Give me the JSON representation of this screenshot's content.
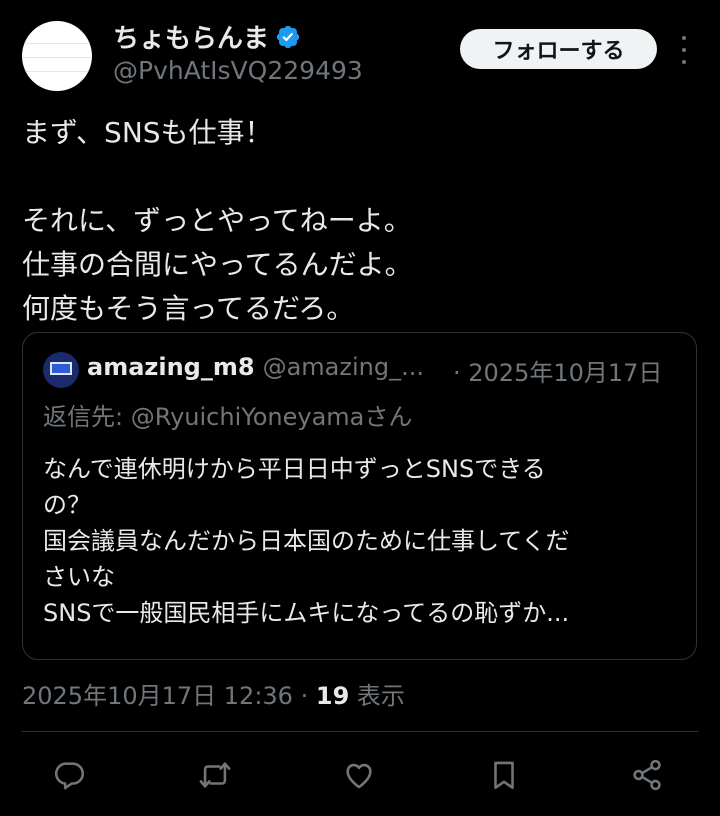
{
  "author": {
    "display_name": "ちょもらんま",
    "handle": "@PvhAtIsVQ229493",
    "follow_label": "フォローする"
  },
  "tweet": {
    "lines": [
      "まず、SNSも仕事！",
      "",
      "それに、ずっとやってねーよ。",
      "仕事の合間にやってるんだよ。",
      "何度もそう言ってるだろ。"
    ],
    "timestamp": "2025年10月17日 12:36",
    "separator": "·",
    "views_count": "19",
    "views_label": "表示"
  },
  "quoted": {
    "display_name": "amazing_m8",
    "handle": "@amazing_...",
    "date": "· 2025年10月17日",
    "reply_prefix": "返信先:",
    "reply_target": "@RyuichiYoneyamaさん",
    "lines": [
      "なんで連休明けから平日日中ずっとSNSできる",
      "の？",
      "国会議員なんだから日本国のために仕事してくだ",
      "さいな",
      "SNSで一般国民相手にムキになってるの恥ずか..."
    ]
  },
  "colors": {
    "background": "#000000",
    "text": "#e7e9ea",
    "muted": "#71767b",
    "verified_badge": "#1d9bf0",
    "follow_button_bg": "#eff3f4"
  },
  "icons": [
    "verified-badge-icon",
    "more-options-icon",
    "reply-icon",
    "repost-icon",
    "like-icon",
    "bookmark-icon",
    "share-icon"
  ]
}
